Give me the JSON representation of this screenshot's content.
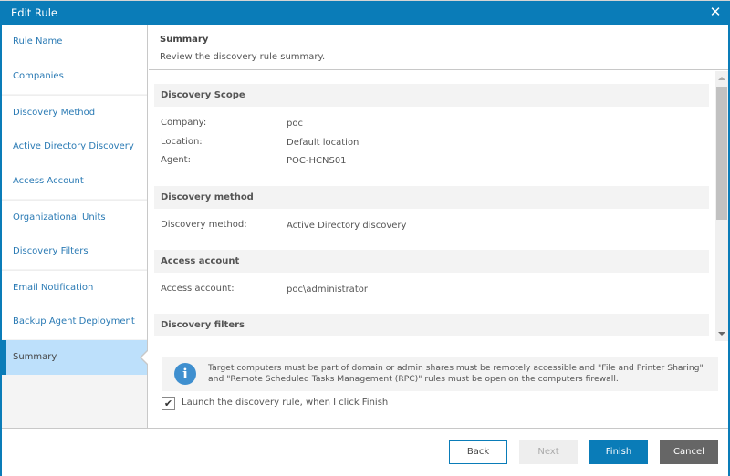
{
  "window": {
    "title": "Edit Rule",
    "close_icon": "close-icon"
  },
  "sidebar": {
    "items": [
      {
        "label": "Rule Name",
        "active": false
      },
      {
        "label": "Companies",
        "active": false
      },
      {
        "label": "Discovery Method",
        "active": false
      },
      {
        "label": "Active Directory Discovery",
        "active": false
      },
      {
        "label": "Access Account",
        "active": false
      },
      {
        "label": "Organizational Units",
        "active": false
      },
      {
        "label": "Discovery Filters",
        "active": false
      },
      {
        "label": "Email Notification",
        "active": false
      },
      {
        "label": "Backup Agent Deployment",
        "active": false
      },
      {
        "label": "Summary",
        "active": true
      }
    ]
  },
  "page": {
    "title": "Summary",
    "subtitle": "Review the discovery rule summary."
  },
  "summary": {
    "discovery_scope": {
      "heading": "Discovery Scope",
      "rows": [
        {
          "label": "Company:",
          "value": "poc"
        },
        {
          "label": "Location:",
          "value": "Default location"
        },
        {
          "label": "Agent:",
          "value": "POC-HCNS01"
        }
      ]
    },
    "discovery_method": {
      "heading": "Discovery method",
      "rows": [
        {
          "label": "Discovery method:",
          "value": "Active Directory discovery"
        }
      ]
    },
    "access_account": {
      "heading": "Access account",
      "rows": [
        {
          "label": "Access account:",
          "value": "poc\\administrator"
        }
      ]
    },
    "discovery_filters": {
      "heading": "Discovery filters"
    }
  },
  "info": {
    "icon": "info-icon",
    "text": "Target computers must be part of domain or admin shares must be remotely accessible and \"File and Printer Sharing\" and \"Remote Scheduled Tasks Management (RPC)\" rules must be open on the computers firewall."
  },
  "launch_option": {
    "label": "Launch the discovery rule, when I click Finish",
    "checked": true
  },
  "footer": {
    "back_label": "Back",
    "next_label": "Next",
    "finish_label": "Finish",
    "cancel_label": "Cancel"
  },
  "colors": {
    "accent": "#0a7cb8",
    "active_nav": "#bde0fb",
    "info_icon": "#3f8fcf",
    "cancel": "#666666"
  }
}
